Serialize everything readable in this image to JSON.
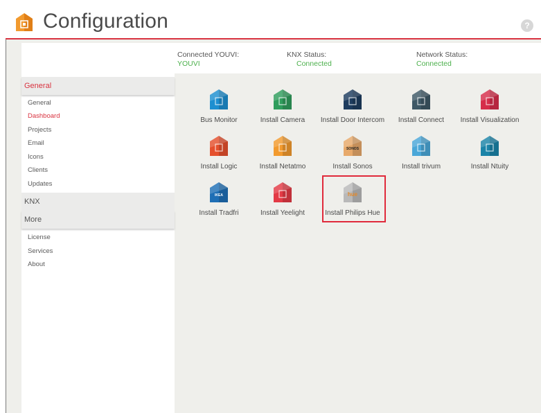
{
  "header": {
    "title": "Configuration",
    "help_label": "?"
  },
  "status": {
    "connected_youvi": {
      "label": "Connected YOUVI:",
      "value": "YOUVI"
    },
    "knx": {
      "label": "KNX Status:",
      "value": "Connected"
    },
    "network": {
      "label": "Network Status:",
      "value": "Connected"
    }
  },
  "sidebar": {
    "general": {
      "label": "General",
      "items": [
        "General",
        "Dashboard",
        "Projects",
        "Email",
        "Icons",
        "Clients",
        "Updates"
      ]
    },
    "knx": {
      "label": "KNX"
    },
    "more": {
      "label": "More",
      "items": [
        "License",
        "Services",
        "About"
      ]
    }
  },
  "tiles": [
    {
      "label": "Bus Monitor",
      "color": "#1d8fd0",
      "icon": "bus-monitor-icon",
      "glyph": ""
    },
    {
      "label": "Install Camera",
      "color": "#2f9d5c",
      "icon": "camera-icon",
      "glyph": ""
    },
    {
      "label": "Install Door Intercom",
      "color": "#1e3c5e",
      "icon": "door-intercom-icon",
      "glyph": ""
    },
    {
      "label": "Install Connect",
      "color": "#3e5866",
      "icon": "connect-icon",
      "glyph": ""
    },
    {
      "label": "Install Visualization",
      "color": "#d62d4a",
      "icon": "visualization-icon",
      "glyph": ""
    },
    {
      "label": "Install Logic",
      "color": "#e5502d",
      "icon": "logic-icon",
      "glyph": ""
    },
    {
      "label": "Install Netatmo",
      "color": "#f29a2e",
      "icon": "netatmo-icon",
      "glyph": ""
    },
    {
      "label": "Install Sonos",
      "color": "#e7a96a",
      "icon": "sonos-icon",
      "glyph": "SONOS"
    },
    {
      "label": "Install trivum",
      "color": "#4aa7d8",
      "icon": "trivum-icon",
      "glyph": ""
    },
    {
      "label": "Install Ntuity",
      "color": "#1b84a8",
      "icon": "ntuity-icon",
      "glyph": ""
    },
    {
      "label": "Install Tradfri",
      "color": "#1f6fb5",
      "icon": "tradfri-icon",
      "glyph": "IKEA"
    },
    {
      "label": "Install Yeelight",
      "color": "#e33a45",
      "icon": "yeelight-icon",
      "glyph": ""
    },
    {
      "label": "Install Philips Hue",
      "color": "#b9b9b9",
      "icon": "philips-hue-icon",
      "glyph": "hue"
    }
  ]
}
